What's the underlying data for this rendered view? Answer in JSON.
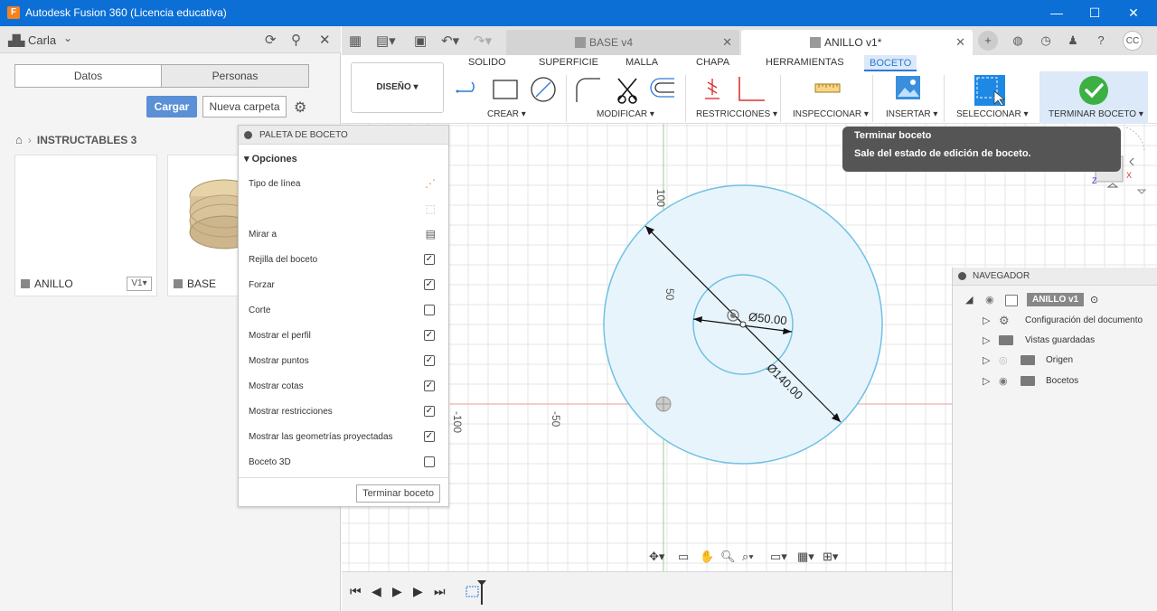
{
  "window": {
    "title": "Autodesk Fusion 360 (Licencia educativa)",
    "app_icon": "F",
    "minimize": "—",
    "maximize": "☐",
    "close": "✕"
  },
  "data_panel": {
    "user": "Carla",
    "tabs": [
      "Datos",
      "Personas"
    ],
    "upload_label": "Cargar",
    "new_folder_label": "Nueva carpeta",
    "breadcrumb": "INSTRUCTABLES 3",
    "files": [
      {
        "name": "ANILLO",
        "version": "V1▾"
      },
      {
        "name": "BASE"
      }
    ]
  },
  "doc_tabs": [
    {
      "name": "BASE v4",
      "active": false
    },
    {
      "name": "ANILLO v1*",
      "active": true
    }
  ],
  "user_initials": "CC",
  "ribbon": {
    "workspace": "DISEÑO ▾",
    "tabs": [
      "SOLIDO",
      "SUPERFICIE",
      "MALLA",
      "CHAPA",
      "HERRAMIENTAS",
      "BOCETO"
    ],
    "active_tab": "BOCETO",
    "groups": [
      "CREAR ▾",
      "MODIFICAR ▾",
      "RESTRICCIONES ▾",
      "INSPECCIONAR ▾",
      "INSERTAR ▾",
      "SELECCIONAR ▾",
      "TERMINAR BOCETO ▾"
    ]
  },
  "tooltip": {
    "title": "Terminar boceto",
    "description": "Sale del estado de edición de boceto."
  },
  "palette": {
    "title": "PALETA DE BOCETO",
    "section": "Opciones",
    "rows": [
      {
        "label": "Tipo de línea",
        "kind": "icon"
      },
      {
        "label": "",
        "kind": "icon"
      },
      {
        "label": "Mirar a",
        "kind": "icon"
      },
      {
        "label": "Rejilla del boceto",
        "kind": "check",
        "checked": "✓"
      },
      {
        "label": "Forzar",
        "kind": "check",
        "checked": "✓"
      },
      {
        "label": "Corte",
        "kind": "check",
        "checked": ""
      },
      {
        "label": "Mostrar el perfil",
        "kind": "check",
        "checked": "✓"
      },
      {
        "label": "Mostrar puntos",
        "kind": "check",
        "checked": "✓"
      },
      {
        "label": "Mostrar cotas",
        "kind": "check",
        "checked": "✓"
      },
      {
        "label": "Mostrar restricciones",
        "kind": "check",
        "checked": "✓"
      },
      {
        "label": "Mostrar las geometrías proyectadas",
        "kind": "check",
        "checked": "✓"
      },
      {
        "label": "Boceto 3D",
        "kind": "check",
        "checked": ""
      }
    ],
    "finish_label": "Terminar boceto"
  },
  "canvas": {
    "axis_labels": {
      "v100": "100",
      "v50": "50",
      "h_minus100": "-100",
      "h_minus50": "-50"
    },
    "dim_small": "Ø50.00",
    "dim_large": "Ø140.00",
    "colors": {
      "grid": "#e4e4e4",
      "circle": "#6ec1e4",
      "fill": "#e8f4fb",
      "x_axis": "#e99",
      "y_axis": "#9c9"
    }
  },
  "navigator": {
    "title": "NAVEGADOR",
    "root": "ANILLO v1",
    "items": [
      "Configuración del documento",
      "Vistas guardadas",
      "Origen",
      "Bocetos"
    ]
  }
}
